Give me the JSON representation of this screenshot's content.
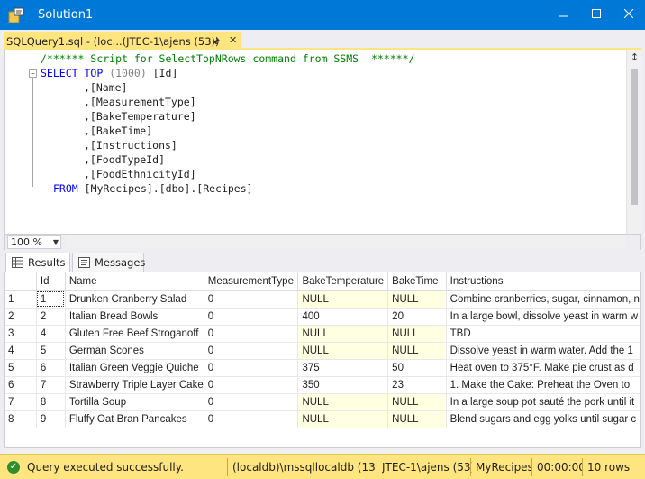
{
  "window": {
    "title": "Solution1"
  },
  "tab": {
    "title": "SQLQuery1.sql - (loc...(JTEC-1\\ajens (53))"
  },
  "editor": {
    "comment": "/****** Script for SelectTopNRows command from SSMS  ******/",
    "select_kw": "SELECT",
    "top_kw": "TOP",
    "top_value": "(1000)",
    "first_col": "[Id]",
    "columns": [
      ",[Name]",
      ",[MeasurementType]",
      ",[BakeTemperature]",
      ",[BakeTime]",
      ",[Instructions]",
      ",[FoodTypeId]",
      ",[FoodEthnicityId]"
    ],
    "from_kw": "FROM",
    "from_table": "[MyRecipes].[dbo].[Recipes]"
  },
  "zoom": {
    "value": "100 %"
  },
  "result_tabs": {
    "results": "Results",
    "messages": "Messages"
  },
  "grid": {
    "headers": [
      "",
      "Id",
      "Name",
      "MeasurementType",
      "BakeTemperature",
      "BakeTime",
      "Instructions"
    ],
    "rows": [
      [
        "1",
        "1",
        "Drunken Cranberry Salad",
        "0",
        "NULL",
        "NULL",
        "Combine cranberries, sugar, cinnamon, n"
      ],
      [
        "2",
        "2",
        "Italian Bread Bowls",
        "0",
        "400",
        "20",
        "In a large bowl, dissolve yeast in warm w"
      ],
      [
        "3",
        "4",
        "Gluten Free Beef Stroganoff",
        "0",
        "NULL",
        "NULL",
        "TBD"
      ],
      [
        "4",
        "5",
        "German Scones",
        "0",
        "NULL",
        "NULL",
        "Dissolve yeast in warm water. Add the 1"
      ],
      [
        "5",
        "6",
        "Italian Green Veggie Quiche",
        "0",
        "375",
        "50",
        "Heat oven to 375°F. Make pie crust as d"
      ],
      [
        "6",
        "7",
        "Strawberry Triple Layer Cake",
        "0",
        "350",
        "23",
        "1. Make the Cake: Preheat the Oven to"
      ],
      [
        "7",
        "8",
        "Tortilla Soup",
        "0",
        "NULL",
        "NULL",
        "In a large soup pot sauté the pork until it"
      ],
      [
        "8",
        "9",
        "Fluffy Oat Bran Pancakes",
        "0",
        "NULL",
        "NULL",
        "Blend sugars and egg yolks until sugar c"
      ]
    ]
  },
  "status": {
    "message": "Query executed successfully.",
    "server": "(localdb)\\mssqllocaldb (13....",
    "user": "JTEC-1\\ajens (53)",
    "database": "MyRecipes",
    "elapsed": "00:00:00",
    "rows": "10 rows"
  },
  "colors": {
    "accent": "#0078d7",
    "tab_highlight": "#ffe57f",
    "keyword": "#0000ff",
    "comment": "#008000",
    "null_cell": "#ffffe1"
  }
}
